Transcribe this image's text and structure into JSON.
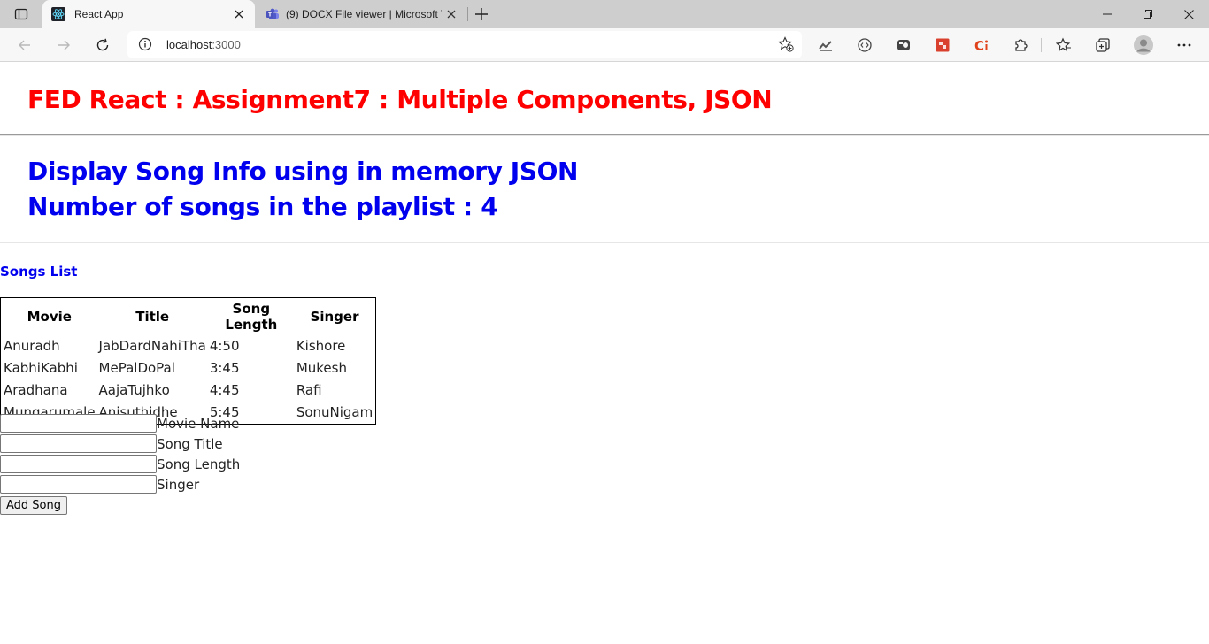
{
  "browser": {
    "tabs": [
      {
        "title": "React App",
        "icon": "react-icon",
        "active": true
      },
      {
        "title": "(9) DOCX File viewer | Microsoft T",
        "icon": "teams-icon",
        "active": false
      }
    ],
    "url": {
      "host": "localhost",
      "port": ":3000"
    },
    "colors": {
      "tabstrip": "#cecece",
      "toolbar": "#f7f7f7"
    }
  },
  "page": {
    "main_heading": "FED React : Assignment7 : Multiple Components, JSON",
    "sub_heading_1": "Display Song Info using in memory JSON",
    "sub_heading_2": "Number of songs in the playlist : 4",
    "songs_list_label": "Songs List",
    "table": {
      "headers": [
        "Movie",
        "Title",
        "Song Length",
        "Singer"
      ],
      "rows": [
        [
          "Anuradh",
          "JabDardNahiTha",
          "4:50",
          "Kishore"
        ],
        [
          "KabhiKabhi",
          "MePalDoPal",
          "3:45",
          "Mukesh"
        ],
        [
          "Aradhana",
          "AajaTujhko",
          "4:45",
          "Rafi"
        ],
        [
          "Mungarumale",
          "Anisuthidhe",
          "5:45",
          "SonuNigam"
        ]
      ]
    },
    "form": {
      "movie_label": "Movie Name",
      "movie_value": "",
      "title_label": "Song Title",
      "title_value": "",
      "length_label": "Song Length",
      "length_value": "",
      "singer_label": "Singer",
      "singer_value": "",
      "add_button": "Add Song"
    },
    "colors": {
      "main_heading": "#ff0000",
      "sub_heading": "#0000ee"
    }
  }
}
